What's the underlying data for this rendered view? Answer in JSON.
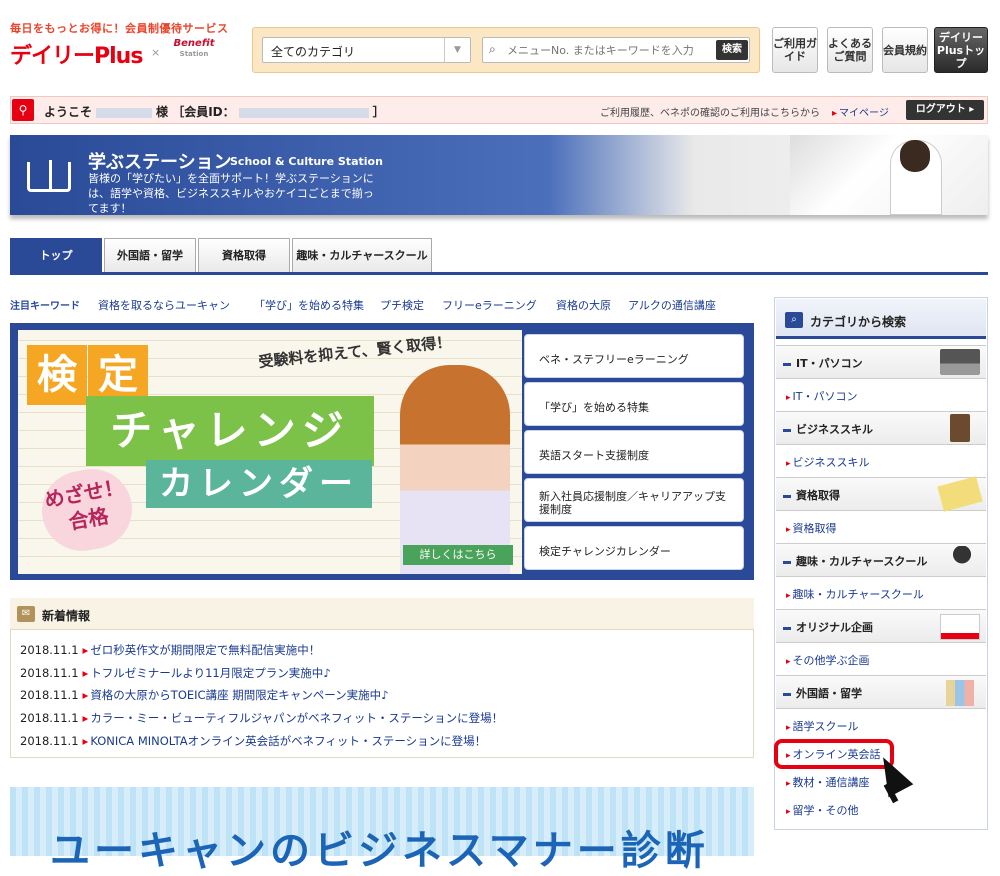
{
  "header": {
    "tagline": "毎日をもっとお得に！会員制優待サービス",
    "logo": "デイリーPlus",
    "logo_separator": "×",
    "partner_logo": "Benefit",
    "partner_logo_sub": "Station",
    "search": {
      "category_value": "全てのカテゴリ",
      "keyword_placeholder": "メニューNo. またはキーワードを入力",
      "search_label": "検索"
    },
    "buttons": [
      "ご利用ガイド",
      "よくあるご質問",
      "会員規約",
      "デイリーPlusトップ"
    ]
  },
  "welcome": {
    "greeting": "ようこそ",
    "honorific": "様 ［会員ID：",
    "close": "］",
    "note": "ご利用履歴、ベネポの確認のご利用はこちらから",
    "mypage": "マイページ",
    "logout": "ログアウト ▸"
  },
  "banner": {
    "title": "学ぶステーション",
    "subtitle": "School & Culture Station",
    "desc": "皆様の「学びたい」を全面サポート！学ぶステーションには、語学や資格、ビジネススキルやおケイコごとまで揃ってます！"
  },
  "tabs": [
    "トップ",
    "外国語・留学",
    "資格取得",
    "趣味・カルチャースクール"
  ],
  "keywords": {
    "label": "注目キーワード",
    "items": [
      "資格を取るならユーキャン",
      "「学び」を始める特集",
      "プチ検定",
      "フリーeラーニング",
      "資格の大原",
      "アルクの通信講座"
    ]
  },
  "hero": {
    "ken": "検",
    "tei": "定",
    "challenge": "チャレンジ",
    "calendar": "カレンダー",
    "catch": "受験料を抑えて、賢く取得！",
    "mezase": "めざせ！合格",
    "detail": "詳しくはこちら",
    "nav": [
      "ベネ・ステフリーeラーニング",
      "「学び」を始める特集",
      "英語スタート支援制度",
      "新入社員応援制度／キャリアアップ支援制度",
      "検定チャレンジカレンダー"
    ]
  },
  "news": {
    "title": "新着情報",
    "items": [
      {
        "date": "2018.11.1",
        "text": "ゼロ秒英作文が期間限定で無料配信実施中！"
      },
      {
        "date": "2018.11.1",
        "text": "トフルゼミナールより11月限定プラン実施中♪"
      },
      {
        "date": "2018.11.1",
        "text": "資格の大原からTOEIC講座 期間限定キャンペーン実施中♪"
      },
      {
        "date": "2018.11.1",
        "text": "カラー・ミー・ビューティフルジャパンがベネフィット・ステーションに登場！"
      },
      {
        "date": "2018.11.1",
        "text": "KONICA MINOLTAオンライン英会話がベネフィット・ステーションに登場！"
      }
    ]
  },
  "bottom_banner": "ユーキャンのビジネスマナー診断",
  "sidebar": {
    "title": "カテゴリから検索",
    "categories": [
      {
        "label": "IT・パソコン",
        "links": [
          "IT・パソコン"
        ]
      },
      {
        "label": "ビジネススキル",
        "links": [
          "ビジネススキル"
        ]
      },
      {
        "label": "資格取得",
        "links": [
          "資格取得"
        ]
      },
      {
        "label": "趣味・カルチャースクール",
        "links": [
          "趣味・カルチャースクール"
        ]
      },
      {
        "label": "オリジナル企画",
        "links": [
          "その他学ぶ企画"
        ]
      },
      {
        "label": "外国語・留学",
        "links": [
          "語学スクール",
          "オンライン英会話",
          "教材・通信講座",
          "留学・その他"
        ]
      }
    ]
  },
  "colors": {
    "brand_red": "#e60012",
    "navy": "#2a4a97",
    "link": "#1a3a8f"
  }
}
